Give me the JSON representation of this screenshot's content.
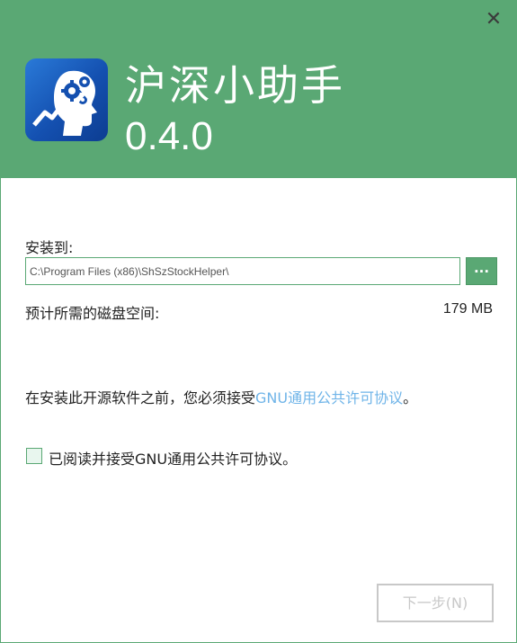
{
  "window": {
    "close_label": "✕"
  },
  "header": {
    "app_name": "沪深小助手",
    "version": "0.4.0",
    "logo_icon": "stock-helper-logo-icon",
    "background_color": "#5aa874"
  },
  "install": {
    "label": "安装到:",
    "path_value": "C:\\Program Files (x86)\\ShSzStockHelper\\",
    "browse_label": "...",
    "space_label": "预计所需的磁盘空间:",
    "space_value": "179 MB"
  },
  "license": {
    "notice_prefix": "在安装此开源软件之前，您必须接受",
    "notice_link": "GNU通用公共许可协议",
    "notice_suffix": "。",
    "checkbox_label": "已阅读并接受GNU通用公共许可协议。",
    "checkbox_checked": false,
    "link_color": "#6fb4e8"
  },
  "footer": {
    "next_label": "下一步(N)",
    "next_enabled": false
  }
}
